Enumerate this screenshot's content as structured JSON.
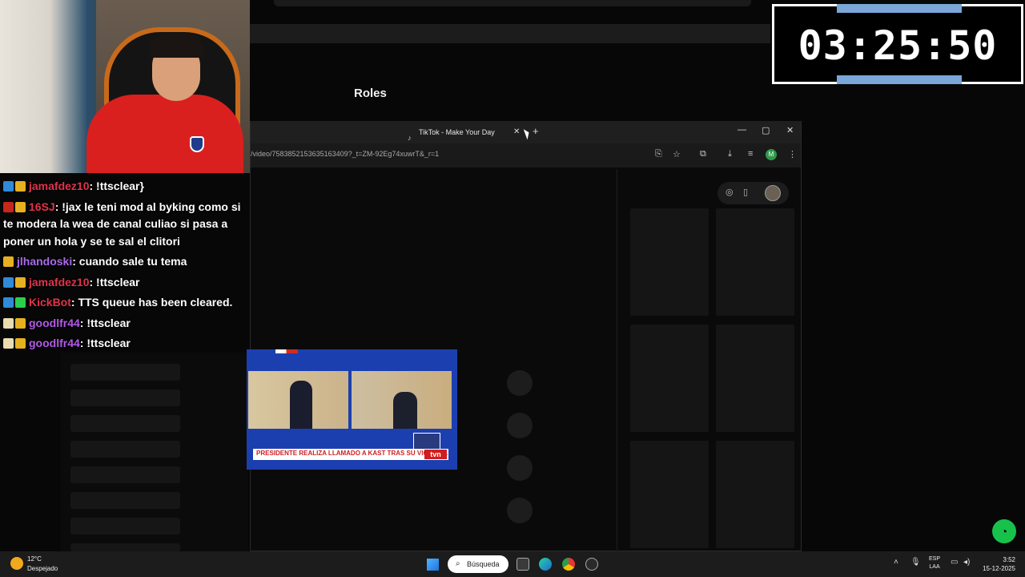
{
  "background": {
    "roles_heading": "Roles"
  },
  "timer": {
    "value": "03:25:50"
  },
  "chat": {
    "messages": [
      {
        "user": "jamafdez10",
        "text": ": !ttsclear}",
        "user_color": "#e0334a",
        "badges": [
          "blue",
          "gold"
        ]
      },
      {
        "user": "16SJ",
        "text": ": !jax le teni mod al byking como si te modera la wea de canal culiao si pasa a poner un hola y se te sal el clitori",
        "user_color": "#e0334a",
        "badges": [
          "red",
          "gold"
        ]
      },
      {
        "user": "jlhandoski",
        "text": ": cuando sale tu tema",
        "user_color": "#a86be8",
        "badges": [
          "gold"
        ]
      },
      {
        "user": "jamafdez10",
        "text": ": !ttsclear",
        "user_color": "#e0334a",
        "badges": [
          "blue",
          "gold"
        ]
      },
      {
        "user": "KickBot",
        "text": ": TTS queue has been cleared.",
        "user_color": "#e0334a",
        "badges": [
          "blue",
          "green"
        ]
      },
      {
        "user": "goodlfr44",
        "text": ": !ttsclear",
        "user_color": "#b25ae8",
        "badges": [
          "cream",
          "gold"
        ]
      },
      {
        "user": "goodlfr44",
        "text": ": !ttsclear",
        "user_color": "#b25ae8",
        "badges": [
          "cream",
          "gold"
        ]
      }
    ]
  },
  "browser": {
    "tab_title": "TikTok - Make Your Day",
    "url": "/video/7583852153635163409?_t=ZM-92Eg74xuwrT&_r=1",
    "profile_initial": "M",
    "icons": [
      "translate-icon",
      "star-icon",
      "extensions-icon",
      "download-icon",
      "media-icon",
      "menu-icon"
    ]
  },
  "video": {
    "chyron": "PRESIDENTE REALIZA LLAMADO A KAST TRAS SU VICTORIA",
    "channel_logo": "tvn"
  },
  "taskbar": {
    "weather_temp": "12°C",
    "weather_desc": "Despejado",
    "search_label": "Búsqueda",
    "lang_top": "ESP",
    "lang_bottom": "LAA",
    "time": "3:52",
    "date": "15-12-2025"
  }
}
